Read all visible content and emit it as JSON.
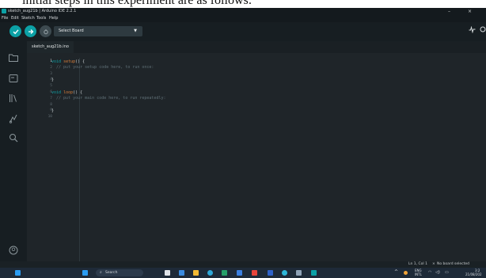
{
  "caption": {
    "text": "initial steps in this experiment are as follows:"
  },
  "window": {
    "title": "sketch_aug21b | Arduino IDE 2.2.1",
    "minimize": "–",
    "close": "×"
  },
  "menu": [
    {
      "label": "File"
    },
    {
      "label": "Edit"
    },
    {
      "label": "Sketch"
    },
    {
      "label": "Tools"
    },
    {
      "label": "Help"
    }
  ],
  "toolbar": {
    "board_select_label": "Select Board",
    "verify_icon": "check-icon",
    "upload_icon": "arrow-right-icon",
    "debug_icon": "debug-icon",
    "accent": "#0ca1a6"
  },
  "tab": {
    "label": "sketch_aug21b.ino"
  },
  "editor": {
    "lines": [
      {
        "n": "1",
        "tokens": [
          {
            "t": "void",
            "c": "kw"
          },
          {
            "t": " ",
            "c": ""
          },
          {
            "t": "setup",
            "c": "fn"
          },
          {
            "t": "() {",
            "c": ""
          }
        ]
      },
      {
        "n": "2",
        "tokens": [
          {
            "t": "  // put your setup code here, to run once:",
            "c": "cm"
          }
        ]
      },
      {
        "n": "3",
        "tokens": []
      },
      {
        "n": "4",
        "tokens": [
          {
            "t": "}",
            "c": ""
          }
        ]
      },
      {
        "n": "5",
        "tokens": []
      },
      {
        "n": "6",
        "tokens": [
          {
            "t": "void",
            "c": "kw"
          },
          {
            "t": " ",
            "c": ""
          },
          {
            "t": "loop",
            "c": "fn"
          },
          {
            "t": "() {",
            "c": ""
          }
        ]
      },
      {
        "n": "7",
        "tokens": [
          {
            "t": "  // put your main code here, to run repeatedly:",
            "c": "cm"
          }
        ]
      },
      {
        "n": "8",
        "tokens": []
      },
      {
        "n": "9",
        "tokens": [
          {
            "t": "}",
            "c": ""
          }
        ]
      },
      {
        "n": "10",
        "tokens": []
      }
    ]
  },
  "status": {
    "position": "Ln 1, Col 1",
    "board": "No board selected"
  },
  "taskbar": {
    "search_label": "Search",
    "lang_line1": "ENG",
    "lang_line2": "INTL",
    "time": "3:2",
    "date": "21/08/202"
  }
}
